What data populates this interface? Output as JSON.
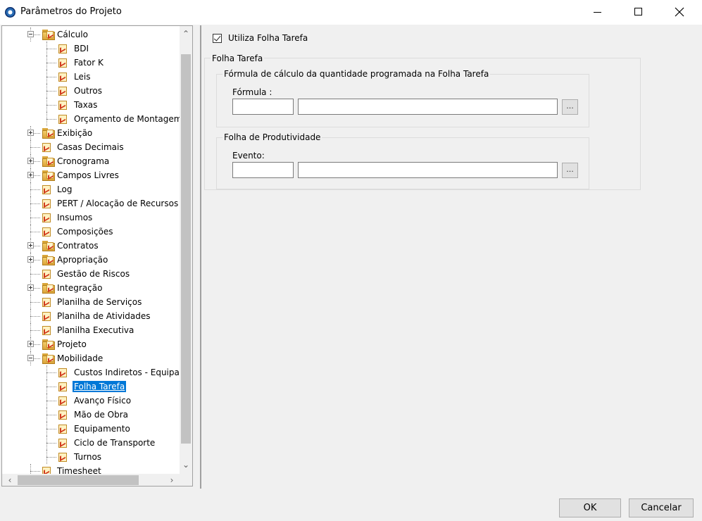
{
  "window": {
    "title": "Parâmetros do Projeto",
    "controls": [
      "minimize-icon",
      "maximize-icon",
      "close-icon"
    ]
  },
  "tree": {
    "nodes": [
      {
        "label": "Cálculo",
        "level": 1,
        "expander": "minus",
        "icon": "folder-icon"
      },
      {
        "label": "BDI",
        "level": 2,
        "icon": "document-icon"
      },
      {
        "label": "Fator K",
        "level": 2,
        "icon": "document-icon"
      },
      {
        "label": "Leis",
        "level": 2,
        "icon": "document-icon"
      },
      {
        "label": "Outros",
        "level": 2,
        "icon": "document-icon"
      },
      {
        "label": "Taxas",
        "level": 2,
        "icon": "document-icon"
      },
      {
        "label": "Orçamento de Montagem",
        "level": 2,
        "icon": "document-icon"
      },
      {
        "label": "Exibição",
        "level": 1,
        "expander": "plus",
        "icon": "folder-icon"
      },
      {
        "label": "Casas Decimais",
        "level": 1,
        "icon": "document-icon"
      },
      {
        "label": "Cronograma",
        "level": 1,
        "expander": "plus",
        "icon": "folder-icon"
      },
      {
        "label": "Campos Livres",
        "level": 1,
        "expander": "plus",
        "icon": "folder-icon"
      },
      {
        "label": "Log",
        "level": 1,
        "icon": "document-icon"
      },
      {
        "label": "PERT / Alocação de Recursos",
        "level": 1,
        "icon": "document-icon"
      },
      {
        "label": "Insumos",
        "level": 1,
        "icon": "document-icon"
      },
      {
        "label": "Composições",
        "level": 1,
        "icon": "document-icon"
      },
      {
        "label": "Contratos",
        "level": 1,
        "expander": "plus",
        "icon": "folder-icon"
      },
      {
        "label": "Apropriação",
        "level": 1,
        "expander": "plus",
        "icon": "folder-icon"
      },
      {
        "label": "Gestão de Riscos",
        "level": 1,
        "icon": "document-icon"
      },
      {
        "label": "Integração",
        "level": 1,
        "expander": "plus",
        "icon": "folder-icon"
      },
      {
        "label": "Planilha de Serviços",
        "level": 1,
        "icon": "document-icon"
      },
      {
        "label": "Planilha de Atividades",
        "level": 1,
        "icon": "document-icon"
      },
      {
        "label": "Planilha Executiva",
        "level": 1,
        "icon": "document-icon"
      },
      {
        "label": "Projeto",
        "level": 1,
        "expander": "plus",
        "icon": "folder-icon"
      },
      {
        "label": "Mobilidade",
        "level": 1,
        "expander": "minus",
        "icon": "folder-icon"
      },
      {
        "label": "Custos Indiretos - Equipamentos",
        "level": 2,
        "icon": "document-icon"
      },
      {
        "label": "Folha Tarefa",
        "level": 2,
        "icon": "document-icon",
        "selected": true
      },
      {
        "label": "Avanço Físico",
        "level": 2,
        "icon": "document-icon"
      },
      {
        "label": "Mão de Obra",
        "level": 2,
        "icon": "document-icon"
      },
      {
        "label": "Equipamento",
        "level": 2,
        "icon": "document-icon"
      },
      {
        "label": "Ciclo de Transporte",
        "level": 2,
        "icon": "document-icon"
      },
      {
        "label": "Turnos",
        "level": 2,
        "icon": "document-icon"
      },
      {
        "label": "Timesheet",
        "level": 1,
        "icon": "document-icon"
      }
    ]
  },
  "settings": {
    "use_checkbox_label": "Utiliza Folha Tarefa",
    "use_checked": true,
    "group_title": "Folha Tarefa",
    "formula_group_title": "Fórmula de cálculo da quantidade programada na Folha Tarefa",
    "formula_label": "Fórmula :",
    "formula_code_value": "",
    "formula_desc_value": "",
    "productivity_group_title": "Folha de Produtividade",
    "event_label": "Evento:",
    "event_code_value": "",
    "event_desc_value": "",
    "browse_label": "..."
  },
  "buttons": {
    "ok": "OK",
    "cancel": "Cancelar"
  }
}
